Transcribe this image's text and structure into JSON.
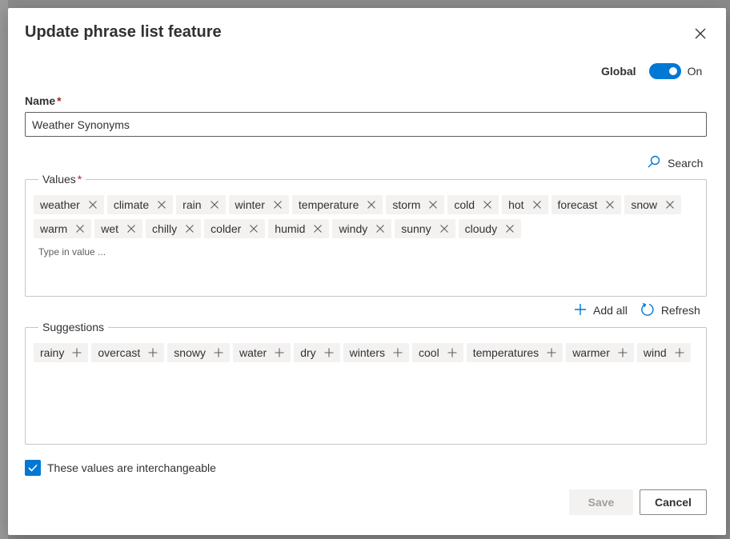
{
  "dialog": {
    "title": "Update phrase list feature",
    "close_icon": "close-icon"
  },
  "global": {
    "label": "Global",
    "toggle_state": "On",
    "accent_color": "#0078d4"
  },
  "name": {
    "label": "Name",
    "required_mark": "*",
    "value": "Weather Synonyms"
  },
  "search": {
    "icon": "search-icon",
    "label": "Search"
  },
  "values": {
    "legend": "Values",
    "required_mark": "*",
    "items": [
      "weather",
      "climate",
      "rain",
      "winter",
      "temperature",
      "storm",
      "cold",
      "hot",
      "forecast",
      "snow",
      "warm",
      "wet",
      "chilly",
      "colder",
      "humid",
      "windy",
      "sunny",
      "cloudy"
    ],
    "input_placeholder": "Type in value ..."
  },
  "actions": {
    "add_all_label": "Add all",
    "add_all_icon": "plus-icon",
    "refresh_label": "Refresh",
    "refresh_icon": "refresh-icon"
  },
  "suggestions": {
    "legend": "Suggestions",
    "items": [
      "rainy",
      "overcast",
      "snowy",
      "water",
      "dry",
      "winters",
      "cool",
      "temperatures",
      "warmer",
      "wind"
    ]
  },
  "interchangeable": {
    "label": "These values are interchangeable",
    "checked": true
  },
  "footer": {
    "save_label": "Save",
    "cancel_label": "Cancel"
  }
}
